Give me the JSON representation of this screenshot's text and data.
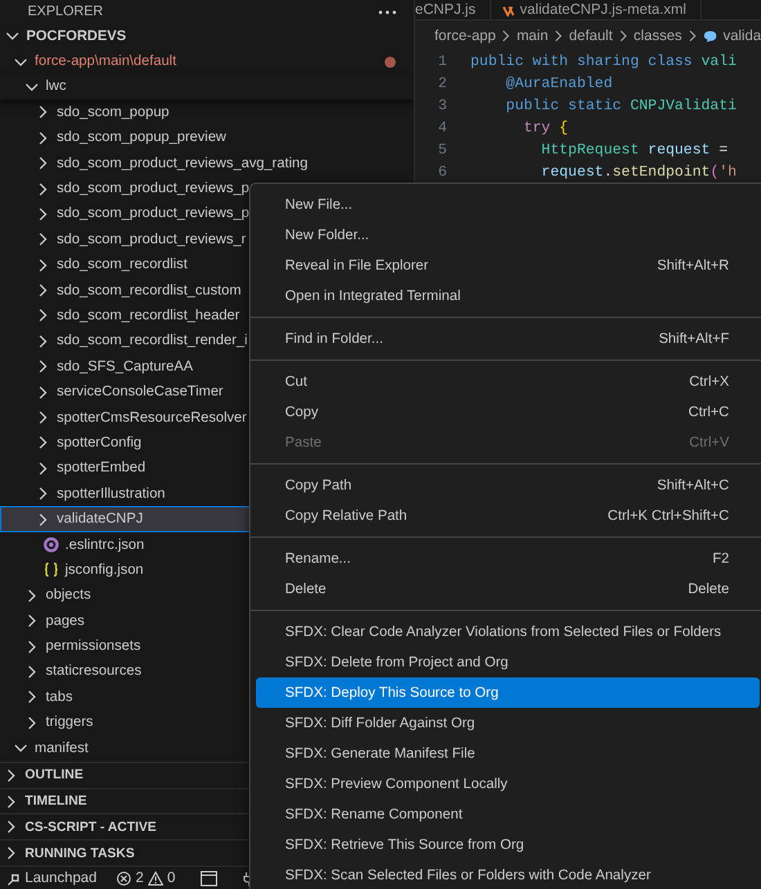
{
  "editor_tabs": [
    {
      "label": "eCNPJ.js",
      "kind": "js"
    },
    {
      "label": "validateCNPJ.js-meta.xml",
      "kind": "xml"
    }
  ],
  "breadcrumbs": [
    "force-app",
    "main",
    "default",
    "classes",
    "valida"
  ],
  "code": [
    {
      "number": "1",
      "tokens": [
        {
          "kind": "keyword",
          "text": "public with sharing class "
        },
        {
          "kind": "type",
          "text": "vali"
        }
      ]
    },
    {
      "number": "2",
      "tokens": [
        {
          "kind": "keyword",
          "text": "    @AuraEnabled"
        }
      ]
    },
    {
      "number": "3",
      "tokens": [
        {
          "kind": "keyword",
          "text": "    public static "
        },
        {
          "kind": "type",
          "text": "CNPJValidati"
        }
      ]
    },
    {
      "number": "4",
      "tokens": [
        {
          "kind": "control",
          "text": "      try "
        },
        {
          "kind": "bracket",
          "text": "{"
        }
      ]
    },
    {
      "number": "5",
      "tokens": [
        {
          "kind": "type",
          "text": "        HttpRequest "
        },
        {
          "kind": "variable",
          "text": "request"
        },
        {
          "kind": "plain",
          "text": " ="
        }
      ]
    },
    {
      "number": "6",
      "tokens": [
        {
          "kind": "variable",
          "text": "        request"
        },
        {
          "kind": "plain",
          "text": "."
        },
        {
          "kind": "function",
          "text": "setEndpoint"
        },
        {
          "kind": "bracket2",
          "text": "("
        },
        {
          "kind": "string",
          "text": "'h"
        }
      ]
    }
  ],
  "explorer": {
    "title": "EXPLORER"
  },
  "tree": [
    {
      "label": "POCFORDEVS",
      "kind": "root",
      "expanded": true,
      "selected": false,
      "modified": false,
      "children": [
        {
          "label": "force-app\\main\\default",
          "kind": "folder",
          "expanded": true,
          "selected": false,
          "modified": true,
          "children": [
            {
              "label": "lwc",
              "kind": "folder",
              "expanded": true,
              "selected": false,
              "modified": false,
              "children": [
                {
                  "label": "sdo_scom_popup",
                  "kind": "folder",
                  "expanded": false,
                  "selected": false,
                  "modified": false
                },
                {
                  "label": "sdo_scom_popup_preview",
                  "kind": "folder",
                  "expanded": false,
                  "selected": false,
                  "modified": false
                },
                {
                  "label": "sdo_scom_product_reviews_avg_rating",
                  "kind": "folder",
                  "expanded": false,
                  "selected": false,
                  "modified": false
                },
                {
                  "label": "sdo_scom_product_reviews_p",
                  "kind": "folder",
                  "expanded": false,
                  "selected": false,
                  "modified": false
                },
                {
                  "label": "sdo_scom_product_reviews_p",
                  "kind": "folder",
                  "expanded": false,
                  "selected": false,
                  "modified": false
                },
                {
                  "label": "sdo_scom_product_reviews_r",
                  "kind": "folder",
                  "expanded": false,
                  "selected": false,
                  "modified": false
                },
                {
                  "label": "sdo_scom_recordlist",
                  "kind": "folder",
                  "expanded": false,
                  "selected": false,
                  "modified": false
                },
                {
                  "label": "sdo_scom_recordlist_custom",
                  "kind": "folder",
                  "expanded": false,
                  "selected": false,
                  "modified": false
                },
                {
                  "label": "sdo_scom_recordlist_header",
                  "kind": "folder",
                  "expanded": false,
                  "selected": false,
                  "modified": false
                },
                {
                  "label": "sdo_scom_recordlist_render_i",
                  "kind": "folder",
                  "expanded": false,
                  "selected": false,
                  "modified": false
                },
                {
                  "label": "sdo_SFS_CaptureAA",
                  "kind": "folder",
                  "expanded": false,
                  "selected": false,
                  "modified": false
                },
                {
                  "label": "serviceConsoleCaseTimer",
                  "kind": "folder",
                  "expanded": false,
                  "selected": false,
                  "modified": false
                },
                {
                  "label": "spotterCmsResourceResolver",
                  "kind": "folder",
                  "expanded": false,
                  "selected": false,
                  "modified": false
                },
                {
                  "label": "spotterConfig",
                  "kind": "folder",
                  "expanded": false,
                  "selected": false,
                  "modified": false
                },
                {
                  "label": "spotterEmbed",
                  "kind": "folder",
                  "expanded": false,
                  "selected": false,
                  "modified": false
                },
                {
                  "label": "spotterIllustration",
                  "kind": "folder",
                  "expanded": false,
                  "selected": false,
                  "modified": false
                },
                {
                  "label": "validateCNPJ",
                  "kind": "folder",
                  "expanded": false,
                  "selected": true,
                  "modified": false
                },
                {
                  "label": ".eslintrc.json",
                  "kind": "config-file",
                  "selected": false,
                  "modified": false
                },
                {
                  "label": "jsconfig.json",
                  "kind": "json-file",
                  "selected": false,
                  "modified": false
                }
              ]
            },
            {
              "label": "objects",
              "kind": "folder",
              "expanded": false,
              "selected": false,
              "modified": false
            },
            {
              "label": "pages",
              "kind": "folder",
              "expanded": false,
              "selected": false,
              "modified": false
            },
            {
              "label": "permissionsets",
              "kind": "folder",
              "expanded": false,
              "selected": false,
              "modified": false
            },
            {
              "label": "staticresources",
              "kind": "folder",
              "expanded": false,
              "selected": false,
              "modified": false
            },
            {
              "label": "tabs",
              "kind": "folder",
              "expanded": false,
              "selected": false,
              "modified": false
            },
            {
              "label": "triggers",
              "kind": "folder",
              "expanded": false,
              "selected": false,
              "modified": false
            }
          ]
        },
        {
          "label": "manifest",
          "kind": "folder",
          "expanded": true,
          "selected": false,
          "modified": false
        }
      ]
    }
  ],
  "sections": [
    {
      "label": "OUTLINE",
      "expanded": false
    },
    {
      "label": "TIMELINE",
      "expanded": false
    },
    {
      "label": "CS-SCRIPT - ACTIVE",
      "expanded": false
    },
    {
      "label": "RUNNING TASKS",
      "expanded": false
    }
  ],
  "status_bar": {
    "launchpad": "Launchpad",
    "errors": "2",
    "warnings": "0"
  },
  "context_menu": {
    "groups": [
      [
        {
          "label": "New File...",
          "disabled": false,
          "selected": false
        },
        {
          "label": "New Folder...",
          "disabled": false,
          "selected": false
        },
        {
          "label": "Reveal in File Explorer",
          "shortcut": "Shift+Alt+R",
          "disabled": false,
          "selected": false
        },
        {
          "label": "Open in Integrated Terminal",
          "disabled": false,
          "selected": false
        }
      ],
      [
        {
          "label": "Find in Folder...",
          "shortcut": "Shift+Alt+F",
          "disabled": false,
          "selected": false
        }
      ],
      [
        {
          "label": "Cut",
          "shortcut": "Ctrl+X",
          "disabled": false,
          "selected": false
        },
        {
          "label": "Copy",
          "shortcut": "Ctrl+C",
          "disabled": false,
          "selected": false
        },
        {
          "label": "Paste",
          "shortcut": "Ctrl+V",
          "disabled": true,
          "selected": false
        }
      ],
      [
        {
          "label": "Copy Path",
          "shortcut": "Shift+Alt+C",
          "disabled": false,
          "selected": false
        },
        {
          "label": "Copy Relative Path",
          "shortcut": "Ctrl+K Ctrl+Shift+C",
          "disabled": false,
          "selected": false
        }
      ],
      [
        {
          "label": "Rename...",
          "shortcut": "F2",
          "disabled": false,
          "selected": false
        },
        {
          "label": "Delete",
          "shortcut": "Delete",
          "disabled": false,
          "selected": false
        }
      ],
      [
        {
          "label": "SFDX: Clear Code Analyzer Violations from Selected Files or Folders",
          "disabled": false,
          "selected": false
        },
        {
          "label": "SFDX: Delete from Project and Org",
          "disabled": false,
          "selected": false
        },
        {
          "label": "SFDX: Deploy This Source to Org",
          "disabled": false,
          "selected": true
        },
        {
          "label": "SFDX: Diff Folder Against Org",
          "disabled": false,
          "selected": false
        },
        {
          "label": "SFDX: Generate Manifest File",
          "disabled": false,
          "selected": false
        },
        {
          "label": "SFDX: Preview Component Locally",
          "disabled": false,
          "selected": false
        },
        {
          "label": "SFDX: Rename Component",
          "disabled": false,
          "selected": false
        },
        {
          "label": "SFDX: Retrieve This Source from Org",
          "disabled": false,
          "selected": false
        },
        {
          "label": "SFDX: Scan Selected Files or Folders with Code Analyzer",
          "disabled": false,
          "selected": false
        }
      ]
    ]
  }
}
